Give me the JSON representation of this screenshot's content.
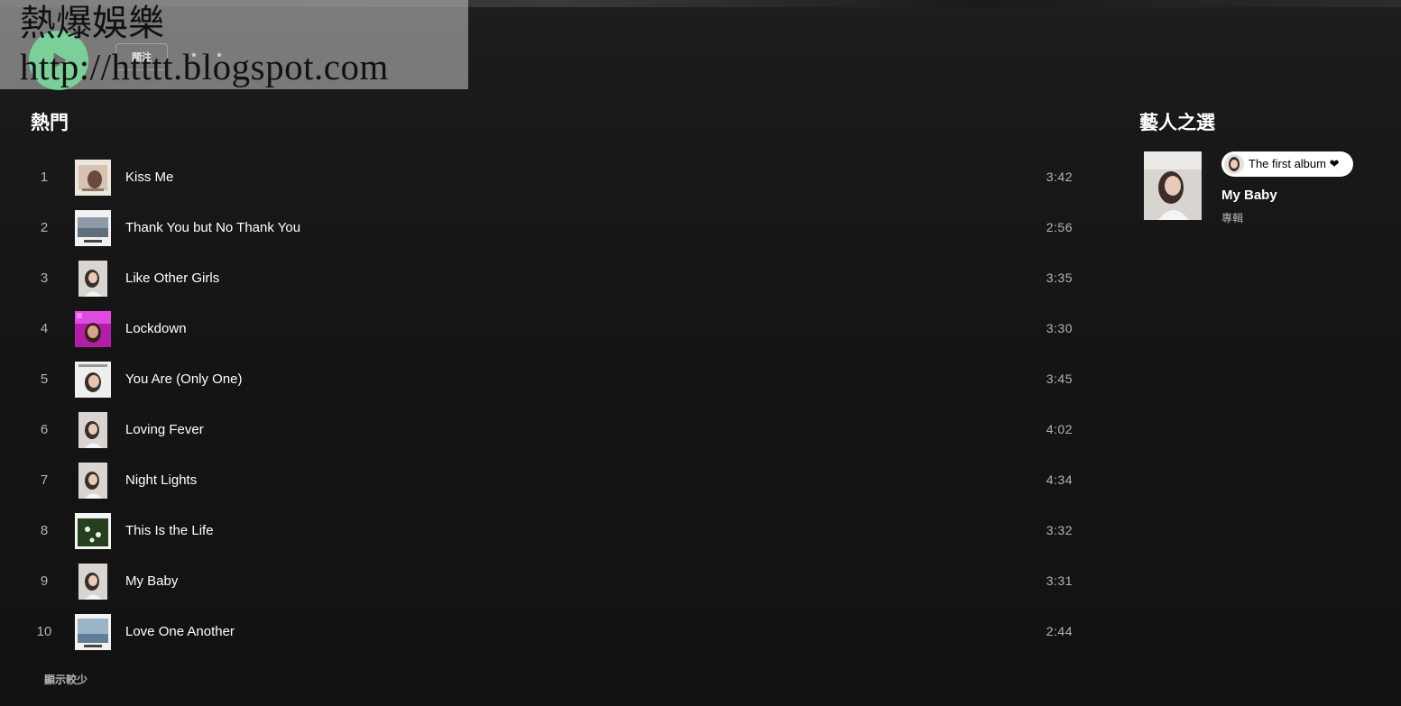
{
  "watermark": {
    "line1": "熱爆娛樂",
    "line2": "http://htttt.blogspot.com"
  },
  "actions": {
    "follow_label": "關注",
    "more_label": "• • •"
  },
  "popular": {
    "title": "熱門",
    "show_less": "顯示較少",
    "tracks": [
      {
        "num": "1",
        "title": "Kiss Me",
        "duration": "3:42",
        "art": "cream"
      },
      {
        "num": "2",
        "title": "Thank You but No Thank You",
        "duration": "2:56",
        "art": "ocean"
      },
      {
        "num": "3",
        "title": "Like Other Girls",
        "duration": "3:35",
        "art": "portrait"
      },
      {
        "num": "4",
        "title": "Lockdown",
        "duration": "3:30",
        "art": "magenta"
      },
      {
        "num": "5",
        "title": "You Are (Only One)",
        "duration": "3:45",
        "art": "light"
      },
      {
        "num": "6",
        "title": "Loving Fever",
        "duration": "4:02",
        "art": "portrait"
      },
      {
        "num": "7",
        "title": "Night Lights",
        "duration": "4:34",
        "art": "portrait"
      },
      {
        "num": "8",
        "title": "This Is the Life",
        "duration": "3:32",
        "art": "green"
      },
      {
        "num": "9",
        "title": "My Baby",
        "duration": "3:31",
        "art": "portrait"
      },
      {
        "num": "10",
        "title": "Love One Another",
        "duration": "2:44",
        "art": "sky"
      }
    ]
  },
  "artist_pick": {
    "title": "藝人之選",
    "badge_text": "The first album ❤",
    "name": "My Baby",
    "type": "專輯"
  },
  "colors": {
    "accent": "#1ed760",
    "background": "#121212",
    "text_secondary": "#b3b3b3"
  }
}
